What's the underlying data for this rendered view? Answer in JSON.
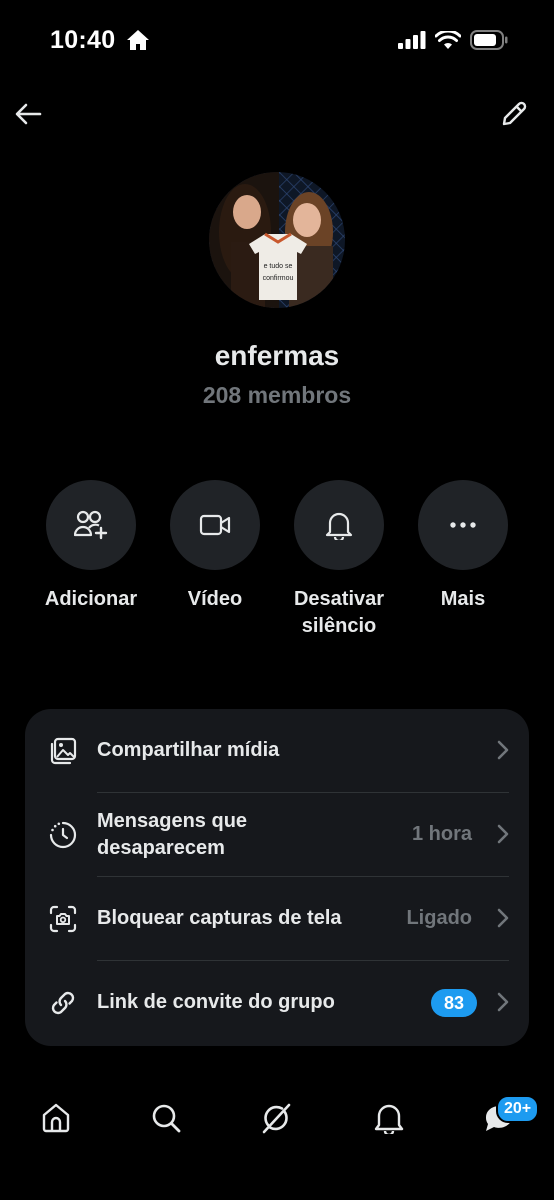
{
  "status_bar": {
    "time": "10:40"
  },
  "colors": {
    "accent": "#1d9bf0",
    "background": "#000000",
    "card": "#16181c",
    "secondary_text": "#71767b"
  },
  "group": {
    "name": "enfermas",
    "members": "208 membros",
    "avatar_text_line1": "e tudo se",
    "avatar_text_line2": "confirmou"
  },
  "actions": [
    {
      "label": "Adicionar",
      "icon": "add-people-icon"
    },
    {
      "label": "Vídeo",
      "icon": "video-camera-icon"
    },
    {
      "label": "Desativar silêncio",
      "icon": "bell-icon"
    },
    {
      "label": "Mais",
      "icon": "more-icon"
    }
  ],
  "settings": [
    {
      "label": "Compartilhar mídia",
      "value": "",
      "icon": "media-icon"
    },
    {
      "label": "Mensagens que desaparecem",
      "value": "1 hora",
      "icon": "timer-icon"
    },
    {
      "label": "Bloquear capturas de tela",
      "value": "Ligado",
      "icon": "screenshot-icon"
    },
    {
      "label": "Link de convite do grupo",
      "value": "",
      "badge": "83",
      "icon": "link-icon"
    }
  ],
  "tabs": [
    {
      "name": "home",
      "icon": "home-icon"
    },
    {
      "name": "search",
      "icon": "search-icon"
    },
    {
      "name": "grok",
      "icon": "grok-icon"
    },
    {
      "name": "notifications",
      "icon": "bell-icon"
    },
    {
      "name": "messages",
      "icon": "messages-icon",
      "badge": "20+"
    }
  ]
}
